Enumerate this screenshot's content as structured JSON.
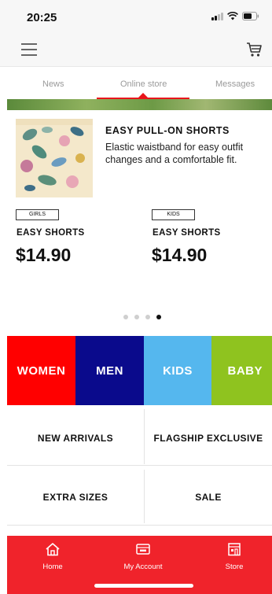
{
  "status_bar": {
    "time": "20:25"
  },
  "header": {
    "menu_icon": "hamburger-menu-icon",
    "cart_icon": "shopping-cart-icon"
  },
  "tabs": [
    {
      "label": "News",
      "active": false
    },
    {
      "label": "Online store",
      "active": true
    },
    {
      "label": "Messages",
      "active": false
    }
  ],
  "promo": {
    "title": "EASY PULL-ON SHORTS",
    "description": "Elastic waistband for easy outfit changes and a comfortable fit."
  },
  "products": [
    {
      "tag": "GIRLS",
      "name": "EASY SHORTS",
      "price": "$14.90"
    },
    {
      "tag": "KIDS",
      "name": "EASY SHORTS",
      "price": "$14.90"
    }
  ],
  "carousel": {
    "page_count": 4,
    "active_index": 3
  },
  "categories": [
    {
      "label": "WOMEN",
      "color": "#ff0000"
    },
    {
      "label": "MEN",
      "color": "#0a0a8c"
    },
    {
      "label": "KIDS",
      "color": "#55b7ee"
    },
    {
      "label": "BABY",
      "color": "#8fc31f"
    }
  ],
  "links": [
    {
      "label": "NEW ARRIVALS"
    },
    {
      "label": "FLAGSHIP EXCLUSIVE"
    },
    {
      "label": "EXTRA SIZES"
    },
    {
      "label": "SALE"
    }
  ],
  "bottom_nav": [
    {
      "label": "Home",
      "icon": "home-icon"
    },
    {
      "label": "My Account",
      "icon": "membership-card-icon"
    },
    {
      "label": "Store",
      "icon": "store-icon"
    }
  ],
  "colors": {
    "accent": "#f0232b",
    "tab_inactive": "#9a9a9a"
  }
}
